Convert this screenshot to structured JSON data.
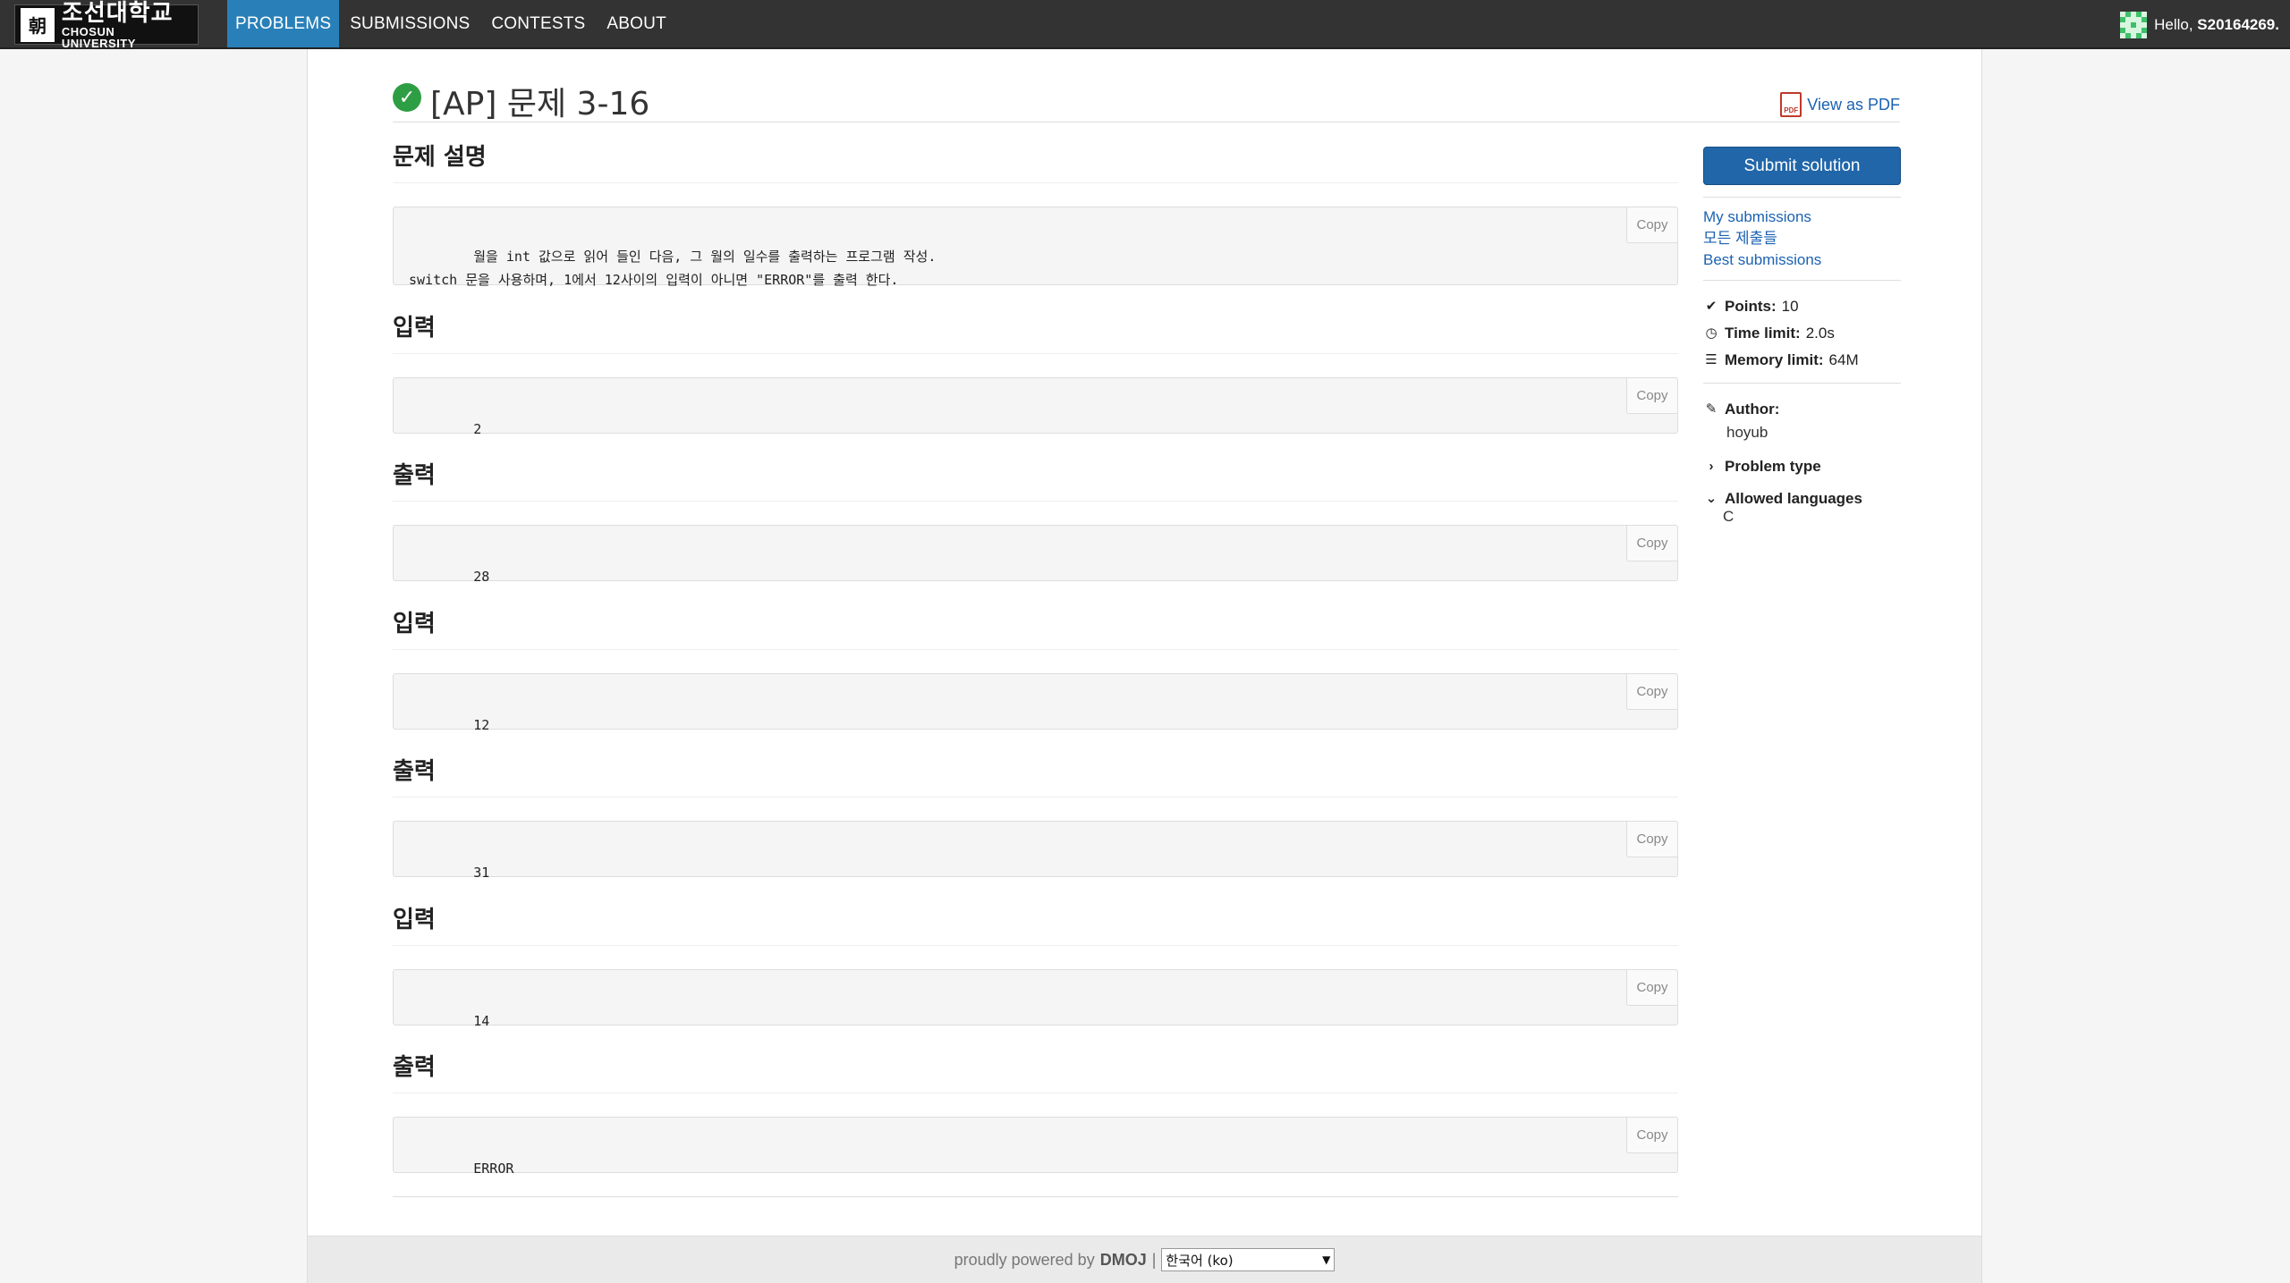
{
  "nav": {
    "logo_ko": "조선대학교",
    "logo_en": "CHOSUN UNIVERSITY",
    "logo_seal": "朝",
    "items": [
      "PROBLEMS",
      "SUBMISSIONS",
      "CONTESTS",
      "ABOUT"
    ],
    "active_item": "PROBLEMS",
    "greeting": "Hello, ",
    "username": "S20164269",
    "greeting_suffix": "."
  },
  "problem": {
    "title": "[AP] 문제 3-16",
    "solved_icon": "check-circle-icon",
    "pdf_label": "View as PDF"
  },
  "sections": [
    {
      "heading": "문제 설명",
      "content": "월을 int 값으로 읽어 들인 다음, 그 월의 일수를 출력하는 프로그램 작성.\nswitch 문을 사용하며, 1에서 12사이의 입력이 아니면 \"ERROR\"를 출력 한다.",
      "copy_label": "Copy"
    },
    {
      "heading": "입력",
      "content": "2",
      "copy_label": "Copy"
    },
    {
      "heading": "출력",
      "content": "28",
      "copy_label": "Copy"
    },
    {
      "heading": "입력",
      "content": "12",
      "copy_label": "Copy"
    },
    {
      "heading": "출력",
      "content": "31",
      "copy_label": "Copy"
    },
    {
      "heading": "입력",
      "content": "14",
      "copy_label": "Copy"
    },
    {
      "heading": "출력",
      "content": "ERROR",
      "copy_label": "Copy"
    }
  ],
  "sidebar": {
    "submit_label": "Submit solution",
    "links": [
      "My submissions",
      "모든 제출들",
      "Best submissions"
    ],
    "points_label": "Points:",
    "points_value": "10",
    "time_label": "Time limit:",
    "time_value": "2.0s",
    "memory_label": "Memory limit:",
    "memory_value": "64M",
    "author_label": "Author:",
    "author_value": "hoyub",
    "problem_type_label": "Problem type",
    "allowed_languages_label": "Allowed languages",
    "allowed_languages_value": "C"
  },
  "footer": {
    "powered_text": "proudly powered by",
    "powered_brand": "DMOJ",
    "separator": "|",
    "language_selected": "한국어 (ko)"
  },
  "colors": {
    "navbar_bg": "#333333",
    "nav_active": "#2980b9",
    "submit_button": "#2066a9",
    "link": "#1b62b3",
    "solved_check": "#2e9e44"
  }
}
